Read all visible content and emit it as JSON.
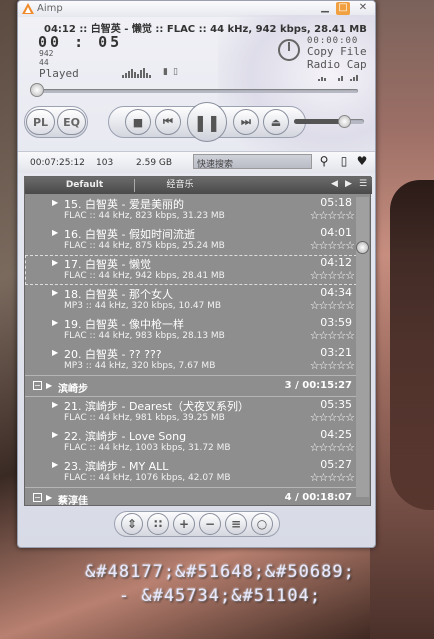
{
  "desktop": {
    "line1": "&#48177;&#51648;&#50689;",
    "line2": "- &#45734;&#51104;"
  },
  "window": {
    "title": "Aimp"
  },
  "player": {
    "marquee": "04:12 :: 白智英 - 懒觉 :: FLAC :: 44 kHz, 942 kbps, 28.41 MB",
    "elapsed": "00 : 05",
    "bitrate": "942",
    "channels": "44",
    "played_label": "Played",
    "zero_time": "00:00:00",
    "copy_file": "Copy File",
    "radio_cap": "Radio Cap",
    "progress": 0.02,
    "volume": 0.75
  },
  "buttons": {
    "pl": "PL",
    "eq": "EQ"
  },
  "statusbar": {
    "total_time": "00:07:25:12",
    "count": "103",
    "size": "2.59 GB",
    "search_placeholder": "快速搜索"
  },
  "tabs": [
    {
      "label": "Default",
      "active": true
    },
    {
      "label": "经音乐",
      "active": false
    }
  ],
  "playlist": [
    {
      "kind": "track",
      "title": "15. 白智英 - 爱是美丽的",
      "duration": "05:18",
      "meta": "FLAC :: 44 kHz, 823 kbps, 31.23 MB",
      "selected": false
    },
    {
      "kind": "track",
      "title": "16. 白智英 - 假如时间流逝",
      "duration": "04:01",
      "meta": "FLAC :: 44 kHz, 875 kbps, 25.24 MB",
      "selected": false
    },
    {
      "kind": "track",
      "title": "17. 白智英 - 懒觉",
      "duration": "04:12",
      "meta": "FLAC :: 44 kHz, 942 kbps, 28.41 MB",
      "selected": true
    },
    {
      "kind": "track",
      "title": "18. 白智英 - 那个女人",
      "duration": "04:34",
      "meta": "MP3 :: 44 kHz, 320 kbps, 10.47 MB",
      "selected": false
    },
    {
      "kind": "track",
      "title": "19. 白智英 - 像中枪一样",
      "duration": "03:59",
      "meta": "FLAC :: 44 kHz, 983 kbps, 28.13 MB",
      "selected": false
    },
    {
      "kind": "track",
      "title": "20. 白智英 - ?? ???",
      "duration": "03:21",
      "meta": "MP3 :: 44 kHz, 320 kbps, 7.67 MB",
      "selected": false
    },
    {
      "kind": "group",
      "name": "滨崎步",
      "info": "3 / 00:15:27"
    },
    {
      "kind": "track",
      "title": "21. 滨崎步 - Dearest（犬夜叉系列）",
      "duration": "05:35",
      "meta": "FLAC :: 44 kHz, 981 kbps, 39.25 MB",
      "selected": false
    },
    {
      "kind": "track",
      "title": "22. 滨崎步 - Love Song",
      "duration": "04:25",
      "meta": "FLAC :: 44 kHz, 1003 kbps, 31.72 MB",
      "selected": false
    },
    {
      "kind": "track",
      "title": "23. 滨崎步 - MY ALL",
      "duration": "05:27",
      "meta": "FLAC :: 44 kHz, 1076 kbps, 42.07 MB",
      "selected": false
    },
    {
      "kind": "group",
      "name": "蔡淳佳",
      "info": "4 / 00:18:07"
    }
  ],
  "icons": {
    "stars": "☆☆☆☆☆",
    "track_arrow": "▶",
    "group_toggle": "−"
  }
}
